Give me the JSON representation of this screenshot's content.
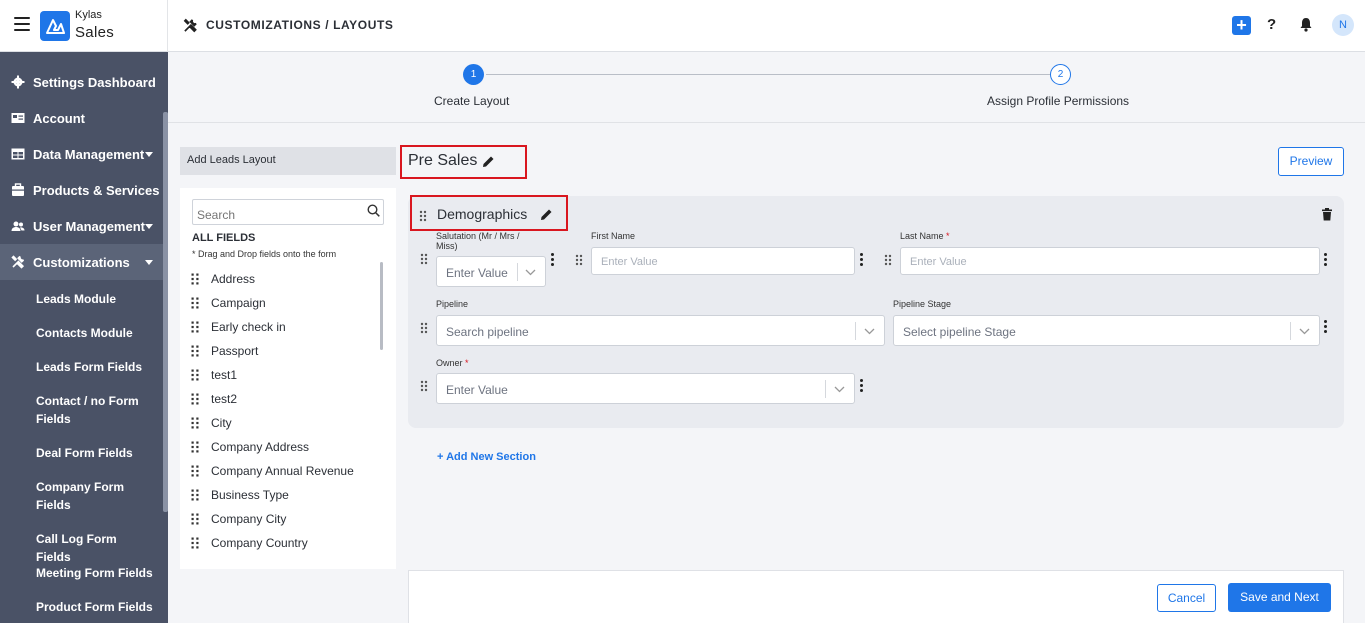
{
  "brand": {
    "line1": "Kylas",
    "line2": "Sales"
  },
  "header": {
    "breadcrumb": "CUSTOMIZATIONS / LAYOUTS",
    "avatar_initial": "N",
    "accent_color": "#1f76e8"
  },
  "sidebar": {
    "items": [
      {
        "label": "Settings Dashboard",
        "icon": "gear-icon"
      },
      {
        "label": "Account",
        "icon": "id-card-icon"
      },
      {
        "label": "Data Management",
        "icon": "table-icon"
      },
      {
        "label": "Products & Services",
        "icon": "box-icon"
      },
      {
        "label": "User Management",
        "icon": "users-icon"
      },
      {
        "label": "Customizations",
        "icon": "tools-icon"
      }
    ],
    "sub_items": [
      "Leads Module",
      "Contacts Module",
      "Leads Form Fields",
      "Contact / no Form Fields",
      "Deal Form Fields",
      "Company Form Fields",
      "Call Log Form Fields",
      "Meeting Form Fields",
      "Product Form Fields"
    ]
  },
  "stepper": {
    "steps": [
      {
        "number": "1",
        "label": "Create Layout"
      },
      {
        "number": "2",
        "label": "Assign Profile Permissions"
      }
    ]
  },
  "left_panel": {
    "add_layout": "Add Leads Layout",
    "search_placeholder": "Search",
    "all_fields": "ALL FIELDS",
    "hint": "* Drag and Drop fields onto the form",
    "fields": [
      "Address",
      "Campaign",
      "Early check in",
      "Passport",
      "test1",
      "test2",
      "City",
      "Company Address",
      "Company Annual Revenue",
      "Business Type",
      "Company City",
      "Company Country"
    ]
  },
  "layout": {
    "name": "Pre Sales",
    "preview": "Preview",
    "section": {
      "name": "Demographics",
      "fields": {
        "salutation": {
          "label": "Salutation (Mr / Mrs / Miss)",
          "value": "Enter Value"
        },
        "first_name": {
          "label": "First Name",
          "placeholder": "Enter Value"
        },
        "last_name": {
          "label": "Last Name",
          "required": "*",
          "placeholder": "Enter Value"
        },
        "pipeline": {
          "label": "Pipeline",
          "value": "Search pipeline"
        },
        "pipeline_stage": {
          "label": "Pipeline Stage",
          "value": "Select pipeline Stage"
        },
        "owner": {
          "label": "Owner",
          "required": "*",
          "value": "Enter Value"
        }
      }
    },
    "add_section": "+ Add New Section"
  },
  "footer": {
    "cancel": "Cancel",
    "save": "Save and Next"
  }
}
